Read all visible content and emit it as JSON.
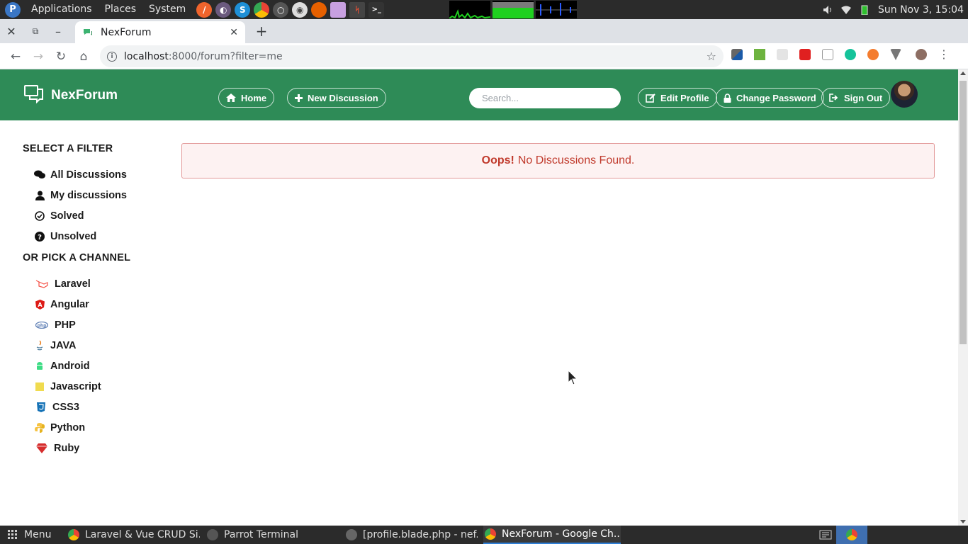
{
  "os_panel": {
    "menus": [
      "Applications",
      "Places",
      "System"
    ],
    "clock": "Sun Nov 3, 15:04"
  },
  "browser": {
    "tab_title": "NexForum",
    "url_host": "localhost",
    "url_rest": ":8000/forum?filter=me"
  },
  "navbar": {
    "brand": "NexForum",
    "home": "Home",
    "new_discussion": "New Discussion",
    "search_placeholder": "Search...",
    "edit_profile": "Edit Profile",
    "change_password": "Change Password",
    "sign_out": "Sign Out"
  },
  "sidebar": {
    "filter_heading": "SELECT A FILTER",
    "filters": [
      {
        "label": "All Discussions",
        "icon": "comments-icon"
      },
      {
        "label": "My discussions",
        "icon": "user-icon"
      },
      {
        "label": "Solved",
        "icon": "check-circle-icon"
      },
      {
        "label": "Unsolved",
        "icon": "question-circle-icon"
      }
    ],
    "channel_heading": "OR PICK A CHANNEL",
    "channels": [
      {
        "label": "Laravel",
        "icon": "laravel-icon",
        "color": "#f55247"
      },
      {
        "label": "Angular",
        "icon": "angular-icon",
        "color": "#dd1b16"
      },
      {
        "label": "PHP",
        "icon": "php-icon",
        "color": "#6181b6"
      },
      {
        "label": "JAVA",
        "icon": "java-icon",
        "color": "#5382a1"
      },
      {
        "label": "Android",
        "icon": "android-icon",
        "color": "#3ddc84"
      },
      {
        "label": "Javascript",
        "icon": "javascript-icon",
        "color": "#f0db4f"
      },
      {
        "label": "CSS3",
        "icon": "css3-icon",
        "color": "#1572b6"
      },
      {
        "label": "Python",
        "icon": "python-icon",
        "color": "#f6c343"
      },
      {
        "label": "Ruby",
        "icon": "ruby-icon",
        "color": "#d62d2d"
      }
    ]
  },
  "alert": {
    "strong": "Oops!",
    "text": "No Discussions Found."
  },
  "taskbar": {
    "menu": "Menu",
    "items": [
      "Laravel & Vue CRUD Si...",
      "Parrot Terminal",
      "[profile.blade.php - nef...",
      "NexForum - Google Ch..."
    ]
  },
  "colors": {
    "navbar_green": "#2e8b57",
    "alert_text": "#c0392b"
  }
}
